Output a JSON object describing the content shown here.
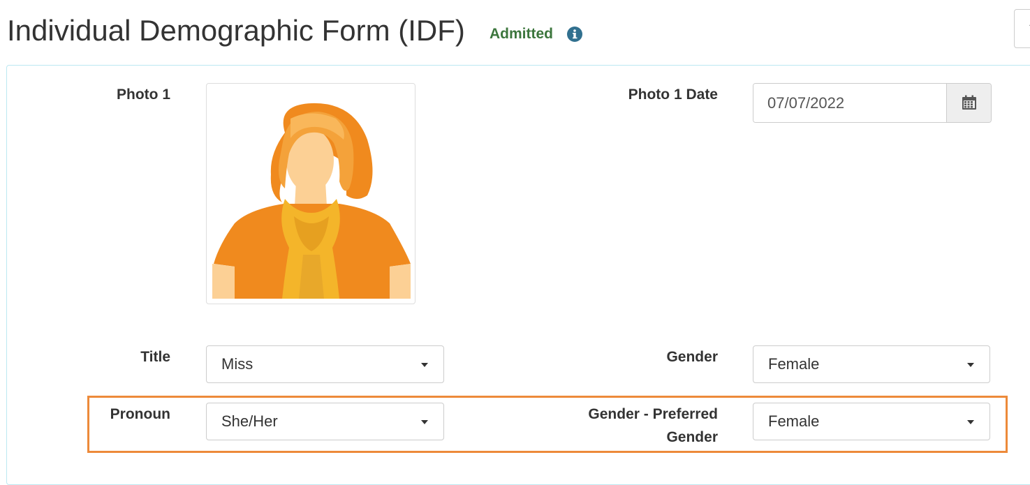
{
  "header": {
    "title": "Individual Demographic Form (IDF)",
    "status": "Admitted",
    "status_color": "#3c763d",
    "info_icon": "info-circle-icon",
    "top_right_button_glyph": "↑"
  },
  "form": {
    "photo": {
      "label": "Photo 1",
      "image_icon": "avatar-female-illustration"
    },
    "photo_date": {
      "label": "Photo 1 Date",
      "value": "07/07/2022",
      "icon": "calendar-icon"
    },
    "title": {
      "label": "Title",
      "value": "Miss"
    },
    "gender": {
      "label": "Gender",
      "value": "Female"
    },
    "pronoun": {
      "label": "Pronoun",
      "value": "She/Her"
    },
    "preferred_gender": {
      "label_line1": "Gender - Preferred",
      "label_line2": "Gender",
      "value": "Female"
    }
  },
  "highlight_color": "#ed8a3a"
}
